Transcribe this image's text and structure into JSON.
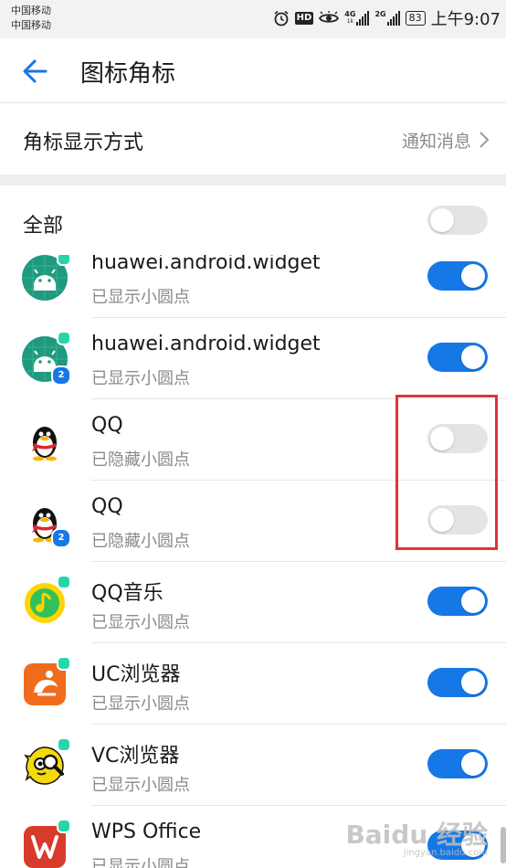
{
  "status_bar": {
    "carrier_1": "中国移动",
    "carrier_2": "中国移动",
    "hd": "HD",
    "net_1": "4G",
    "net_1_sub": "1k",
    "net_2": "2G",
    "battery": "83",
    "time": "上午9:07"
  },
  "app_bar": {
    "title": "图标角标"
  },
  "display_mode": {
    "label": "角标显示方式",
    "value": "通知消息"
  },
  "all_toggle": {
    "label": "全部",
    "on": false
  },
  "apps": [
    {
      "name": "huawei.android.widget",
      "status": "已显示小圆点",
      "on": true,
      "icon": "android-icon"
    },
    {
      "name": "huawei.android.widget",
      "status": "已显示小圆点",
      "on": true,
      "icon": "android-icon",
      "clone_badge": "2"
    },
    {
      "name": "QQ",
      "status": "已隐藏小圆点",
      "on": false,
      "icon": "qq-penguin-icon"
    },
    {
      "name": "QQ",
      "status": "已隐藏小圆点",
      "on": false,
      "icon": "qq-penguin-icon",
      "clone_badge": "2"
    },
    {
      "name": "QQ音乐",
      "status": "已显示小圆点",
      "on": true,
      "icon": "qq-music-icon"
    },
    {
      "name": "UC浏览器",
      "status": "已显示小圆点",
      "on": true,
      "icon": "uc-browser-icon"
    },
    {
      "name": "VC浏览器",
      "status": "已显示小圆点",
      "on": true,
      "icon": "vc-browser-icon"
    },
    {
      "name": "WPS Office",
      "status": "已显示小圆点",
      "on": true,
      "icon": "wps-office-icon"
    }
  ],
  "watermark": {
    "main": "Baidu 经验",
    "sub": "jingyan.baidu.com"
  },
  "colors": {
    "accent": "#1677e6",
    "dot": "#27d6a8",
    "annotation": "#e0333c"
  }
}
